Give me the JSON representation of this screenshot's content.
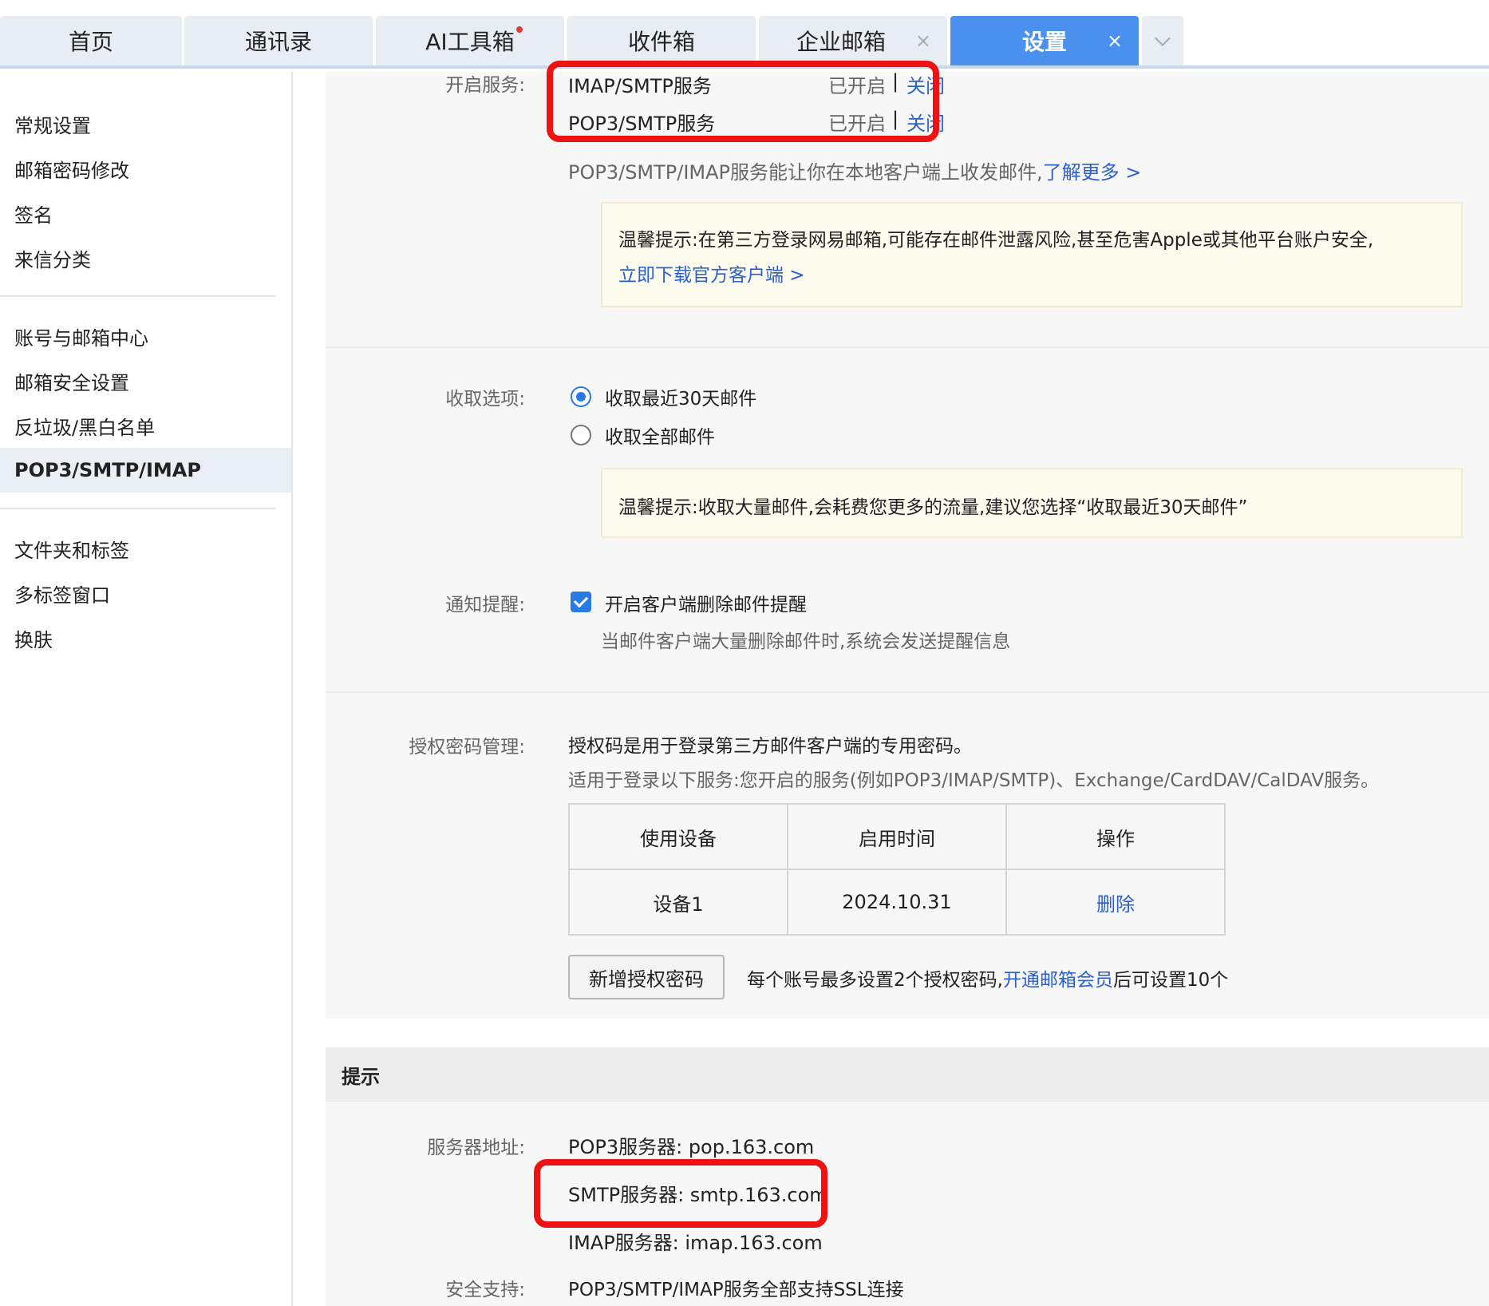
{
  "tabs": [
    {
      "label": "首页"
    },
    {
      "label": "通讯录"
    },
    {
      "label": "AI工具箱"
    },
    {
      "label": "收件箱"
    },
    {
      "label": "企业邮箱"
    },
    {
      "label": "设置"
    }
  ],
  "tab_close": "×",
  "sidebar": {
    "group1": [
      "常规设置",
      "邮箱密码修改",
      "签名",
      "来信分类"
    ],
    "group2": [
      "账号与邮箱中心",
      "邮箱安全设置",
      "反垃圾/黑白名单",
      "POP3/SMTP/IMAP"
    ],
    "group3": [
      "文件夹和标签",
      "多标签窗口",
      "换肤"
    ]
  },
  "services": {
    "label": "开启服务:",
    "rows": [
      {
        "name": "IMAP/SMTP服务",
        "status": "已开启",
        "sep": "|",
        "action": "关闭"
      },
      {
        "name": "POP3/SMTP服务",
        "status": "已开启",
        "sep": "|",
        "action": "关闭"
      }
    ],
    "desc": "POP3/SMTP/IMAP服务能让你在本地客户端上收发邮件,",
    "learn_more": "了解更多 >",
    "tip": "温馨提示:在第三方登录网易邮箱,可能存在邮件泄露风险,甚至危害Apple或其他平台账户安全,",
    "tip_link": "立即下载官方客户端 >"
  },
  "fetch": {
    "label": "收取选项:",
    "options": [
      "收取最近30天邮件",
      "收取全部邮件"
    ],
    "selected": "收取最近30天邮件",
    "tip": "温馨提示:收取大量邮件,会耗费您更多的流量,建议您选择“收取最近30天邮件”"
  },
  "notify": {
    "label": "通知提醒:",
    "checkbox_label": "开启客户端删除邮件提醒",
    "checked": true,
    "desc": "当邮件客户端大量删除邮件时,系统会发送提醒信息"
  },
  "auth": {
    "label": "授权密码管理:",
    "line1": "授权码是用于登录第三方邮件客户端的专用密码。",
    "line2": "适用于登录以下服务:您开启的服务(例如POP3/IMAP/SMTP)、Exchange/CardDAV/CalDAV服务。",
    "table_headers": [
      "使用设备",
      "启用时间",
      "操作"
    ],
    "table_rows": [
      [
        "设备1",
        "2024.10.31",
        "删除"
      ]
    ],
    "add_button": "新增授权密码",
    "note_prefix": "每个账号最多设置2个授权密码,",
    "note_link": "开通邮箱会员",
    "note_suffix": "后可设置10个"
  },
  "hint": {
    "title": "提示",
    "server_label": "服务器地址:",
    "servers": [
      "POP3服务器: pop.163.com",
      "SMTP服务器: smtp.163.com",
      "IMAP服务器: imap.163.com"
    ],
    "security_label": "安全支持:",
    "security_text": "POP3/SMTP/IMAP服务全部支持SSL连接"
  },
  "colors": {
    "accent": "#4a90ee",
    "link": "#2a5fd0",
    "highlight": "#ee1212"
  }
}
